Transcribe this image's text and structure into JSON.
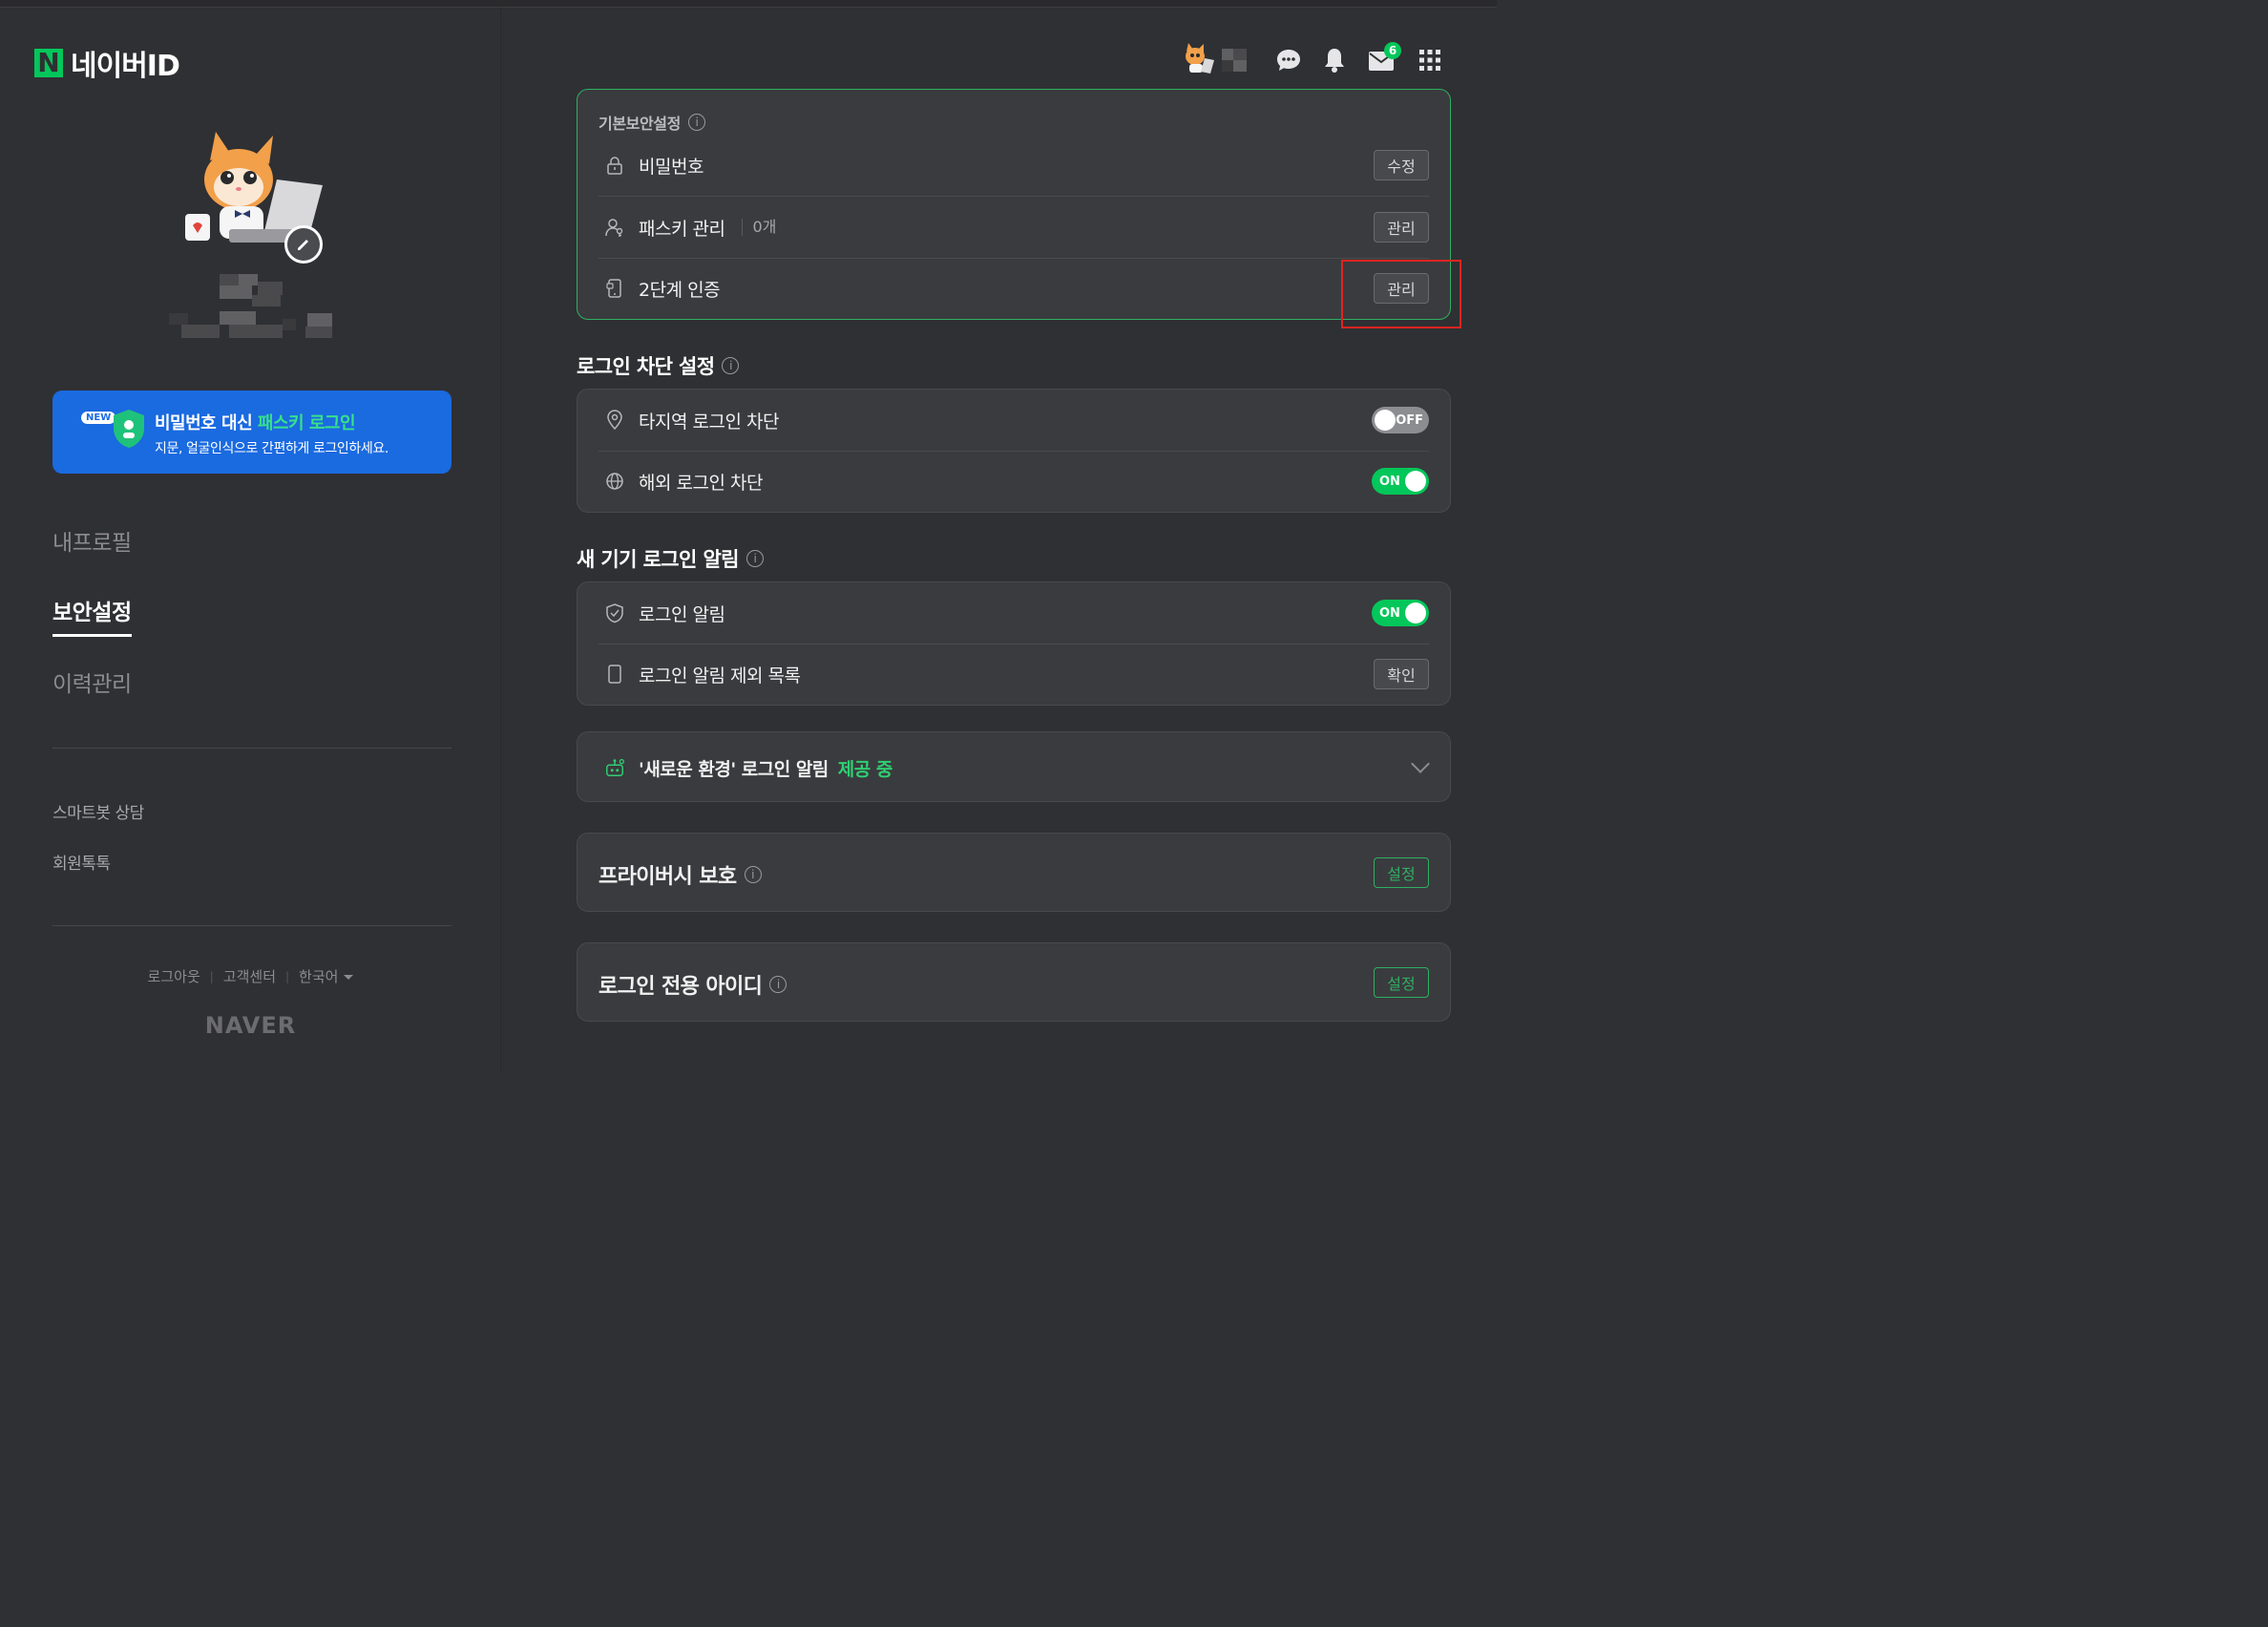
{
  "brand": {
    "logo_letter": "N",
    "title": "네이버ID",
    "footer_logo": "NAVER",
    "accent": "#03c75a"
  },
  "banner": {
    "badge": "NEW",
    "title_prefix": "비밀번호 대신 ",
    "title_accent": "패스키 로그인",
    "subtitle": "지문, 얼굴인식으로 간편하게 로그인하세요.",
    "bg": "#1a6ae0"
  },
  "nav": {
    "items": [
      {
        "label": "내프로필"
      },
      {
        "label": "보안설정"
      },
      {
        "label": "이력관리"
      }
    ],
    "active": "보안설정"
  },
  "links": {
    "chatbot": "스마트봇 상담",
    "member_talk": "회원톡톡"
  },
  "footer": {
    "logout": "로그아웃",
    "help": "고객센터",
    "language": "한국어"
  },
  "topbar": {
    "mail_count": "6"
  },
  "basic_security": {
    "heading": "기본보안설정",
    "rows": [
      {
        "label": "비밀번호",
        "button": "수정"
      },
      {
        "label": "패스키 관리",
        "count": "0개",
        "button": "관리"
      },
      {
        "label": "2단계 인증",
        "button": "관리"
      }
    ]
  },
  "login_block": {
    "title": "로그인 차단 설정",
    "rows": [
      {
        "label": "타지역 로그인 차단",
        "toggle": "OFF"
      },
      {
        "label": "해외 로그인 차단",
        "toggle": "ON"
      }
    ]
  },
  "new_device": {
    "title": "새 기기 로그인 알림",
    "rows": [
      {
        "label": "로그인 알림",
        "toggle": "ON"
      },
      {
        "label": "로그인 알림 제외 목록",
        "button": "확인"
      }
    ]
  },
  "new_env": {
    "text": "'새로운 환경' 로그인 알림",
    "status": "제공 중"
  },
  "privacy": {
    "title": "프라이버시 보호",
    "button": "설정"
  },
  "login_id": {
    "title": "로그인 전용 아이디",
    "button": "설정"
  }
}
